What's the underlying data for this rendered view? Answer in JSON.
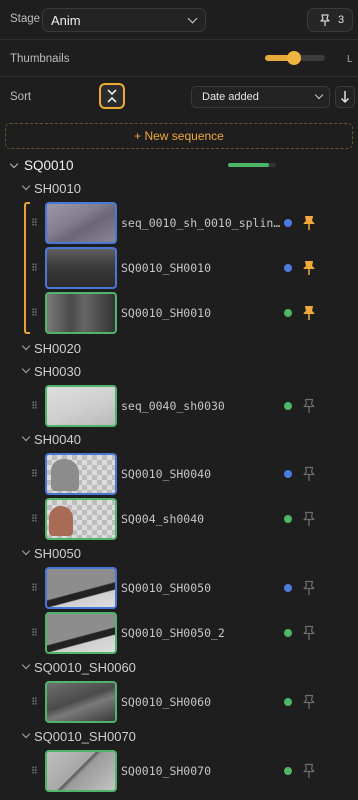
{
  "toolbar": {
    "stage_label": "Stage",
    "stage_value": "Anim",
    "pin_count": "3",
    "thumbnails_label": "Thumbnails",
    "thumbnail_size_percent": 50,
    "thumbnail_size_max_label": "L",
    "sort_label": "Sort",
    "sort_value": "Date added"
  },
  "new_sequence_label": "+ New sequence",
  "sequence": {
    "name": "SQ0010",
    "progress_percent": 85
  },
  "shots": [
    {
      "name": "SH0010",
      "items": [
        {
          "name": "seq_0010_sh_0010_splin…",
          "status": "blue",
          "pinned": true
        },
        {
          "name": "SQ0010_SH0010",
          "status": "blue",
          "pinned": true
        },
        {
          "name": "SQ0010_SH0010",
          "status": "green",
          "pinned": true
        }
      ]
    },
    {
      "name": "SH0020",
      "items": []
    },
    {
      "name": "SH0030",
      "items": [
        {
          "name": "seq_0040_sh0030",
          "status": "green",
          "pinned": false
        }
      ]
    },
    {
      "name": "SH0040",
      "items": [
        {
          "name": "SQ0010_SH0040",
          "status": "blue",
          "pinned": false
        },
        {
          "name": "SQ004_sh0040",
          "status": "green",
          "pinned": false
        }
      ]
    },
    {
      "name": "SH0050",
      "items": [
        {
          "name": "SQ0010_SH0050",
          "status": "blue",
          "pinned": false
        },
        {
          "name": "SQ0010_SH0050_2",
          "status": "green",
          "pinned": false
        }
      ]
    },
    {
      "name": "SQ0010_SH0060",
      "items": [
        {
          "name": "SQ0010_SH0060",
          "status": "green",
          "pinned": false
        }
      ]
    },
    {
      "name": "SQ0010_SH0070",
      "items": [
        {
          "name": "SQ0010_SH0070",
          "status": "green",
          "pinned": false
        }
      ]
    }
  ],
  "colors": {
    "accent": "#f0a93a",
    "status_blue": "#4b7be0",
    "status_green": "#4fb668",
    "background": "#1e1e1e"
  }
}
